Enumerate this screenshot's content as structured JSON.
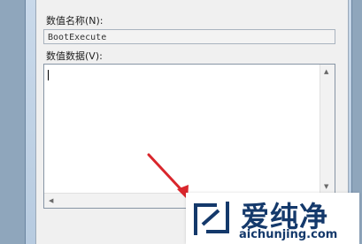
{
  "dialog": {
    "value_name_label": "数值名称(N):",
    "value_name": "BootExecute",
    "value_data_label": "数值数据(V):",
    "value_data": ""
  },
  "watermark": {
    "brand_zh": "爱纯净",
    "brand_url": "aichunjing.com"
  },
  "colors": {
    "window_frame": "#c9d9ea",
    "dialog_bg": "#f0f0f0",
    "arrow_red": "#d9262c",
    "brand_blue": "#14396b"
  },
  "icons": {
    "logo": "aichunjing-logo-icon",
    "annotation_arrow": "red-arrow-icon"
  }
}
